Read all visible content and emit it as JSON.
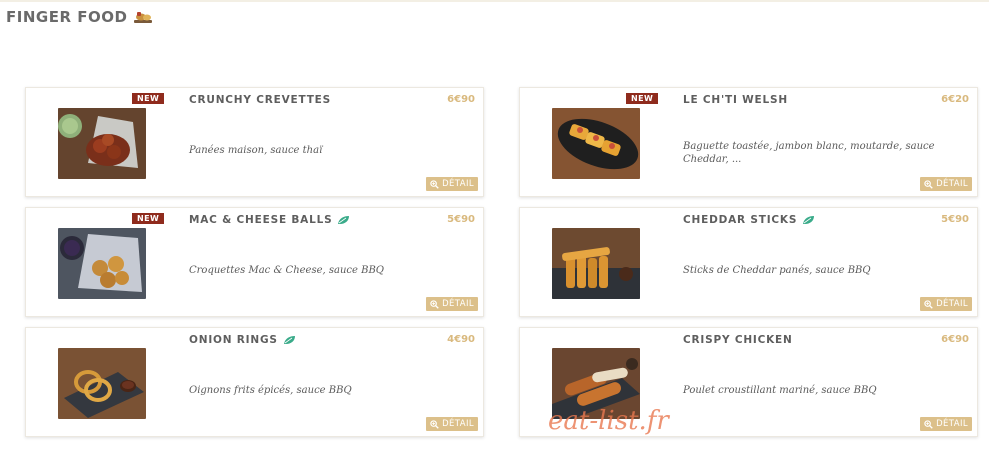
{
  "section": {
    "title": "FINGER FOOD",
    "icon": "food-tray-icon"
  },
  "detail_label": "DÉTAIL",
  "colors": {
    "price": "#d9b97e",
    "badge": "#8f2b1d",
    "button": "#dcc08a",
    "leaf": "#3aab8a"
  },
  "items": [
    {
      "name": "CRUNCHY CREVETTES",
      "price": "6€90",
      "desc": "Panées maison, sauce thaï",
      "badge": "NEW",
      "veggie": false
    },
    {
      "name": "LE CH'TI WELSH",
      "price": "6€20",
      "desc": "Baguette toastée, jambon blanc, moutarde, sauce Cheddar, ...",
      "badge": "NEW",
      "veggie": false
    },
    {
      "name": "MAC & CHEESE BALLS",
      "price": "5€90",
      "desc": "Croquettes Mac & Cheese, sauce BBQ",
      "badge": "NEW",
      "veggie": true
    },
    {
      "name": "CHEDDAR STICKS",
      "price": "5€90",
      "desc": "Sticks de Cheddar panés, sauce BBQ",
      "badge": "",
      "veggie": true
    },
    {
      "name": "ONION RINGS",
      "price": "4€90",
      "desc": "Oignons frits épicés, sauce BBQ",
      "badge": "",
      "veggie": true
    },
    {
      "name": "CRISPY CHICKEN",
      "price": "6€90",
      "desc": "Poulet croustillant mariné, sauce BBQ",
      "badge": "",
      "veggie": false
    }
  ],
  "watermark": "eat-list.fr"
}
